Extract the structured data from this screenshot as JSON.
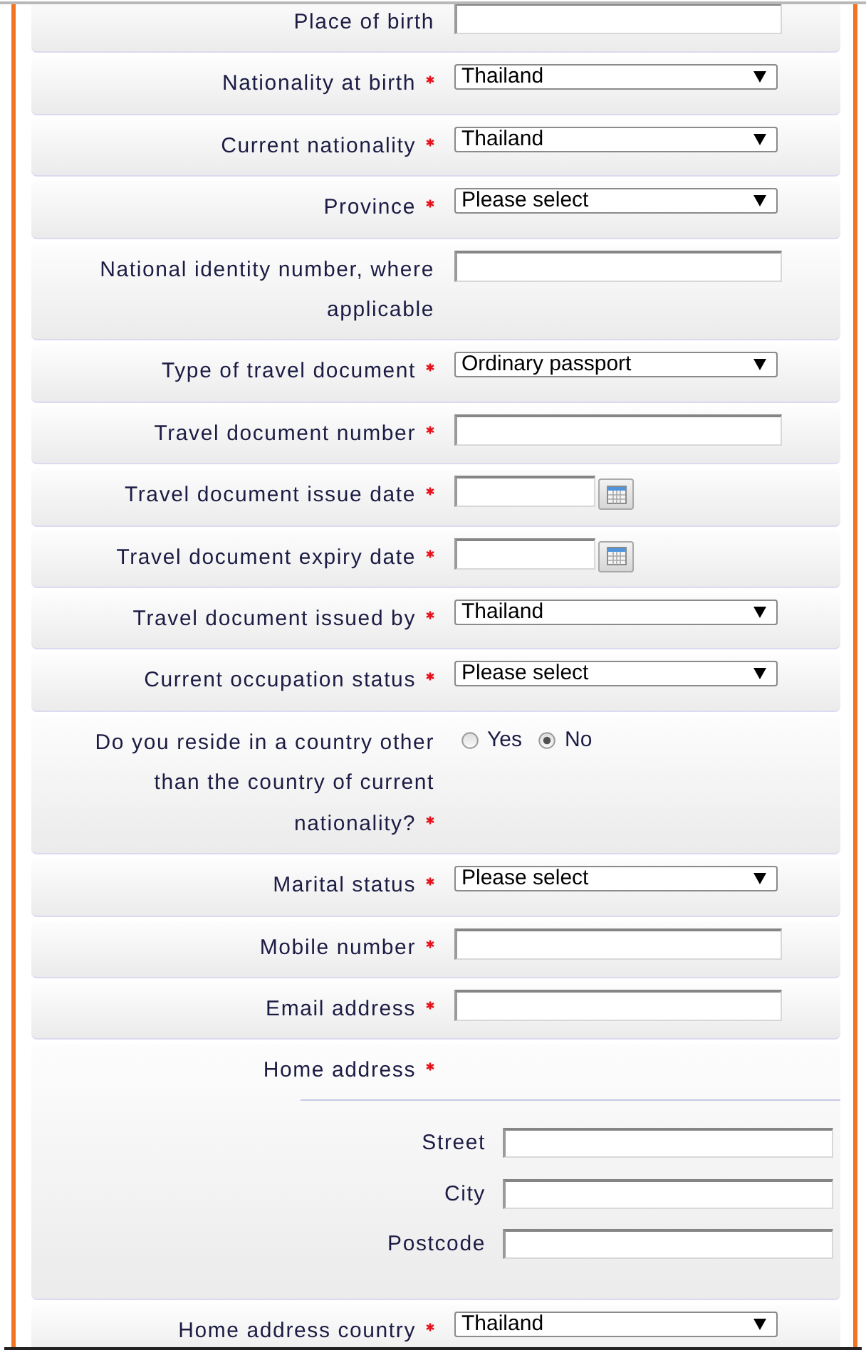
{
  "form": {
    "fields": [
      {
        "kind": "text",
        "label": "Place of birth",
        "required": false
      },
      {
        "kind": "select",
        "label": "Nationality at birth",
        "required": true,
        "value": "Thailand"
      },
      {
        "kind": "select",
        "label": "Current nationality",
        "required": true,
        "value": "Thailand"
      },
      {
        "kind": "select",
        "label": "Province",
        "required": true,
        "value": "Please select"
      },
      {
        "kind": "text",
        "label": "National identity number, where applicable",
        "required": false
      },
      {
        "kind": "select",
        "label": "Type of travel document",
        "required": true,
        "value": "Ordinary passport"
      },
      {
        "kind": "text",
        "label": "Travel document number",
        "required": true
      },
      {
        "kind": "date",
        "label": "Travel document issue date",
        "required": true
      },
      {
        "kind": "date",
        "label": "Travel document expiry date",
        "required": true
      },
      {
        "kind": "select",
        "label": "Travel document issued by",
        "required": true,
        "value": "Thailand"
      },
      {
        "kind": "select",
        "label": "Current occupation status",
        "required": true,
        "value": "Please select"
      },
      {
        "kind": "radio",
        "label": "Do you reside in a country other than the country of current nationality?",
        "required": true,
        "options": [
          {
            "label": "Yes",
            "selected": false
          },
          {
            "label": "No",
            "selected": true
          }
        ]
      },
      {
        "kind": "select",
        "label": "Marital status",
        "required": true,
        "value": "Please select"
      },
      {
        "kind": "text",
        "label": "Mobile number",
        "required": true
      },
      {
        "kind": "text",
        "label": "Email address",
        "required": true
      },
      {
        "kind": "address",
        "label": "Home address",
        "required": true,
        "fields": [
          {
            "label": "Street"
          },
          {
            "label": "City"
          },
          {
            "label": "Postcode"
          }
        ]
      },
      {
        "kind": "select",
        "label": "Home address country",
        "required": true,
        "value": "Thailand"
      }
    ]
  }
}
